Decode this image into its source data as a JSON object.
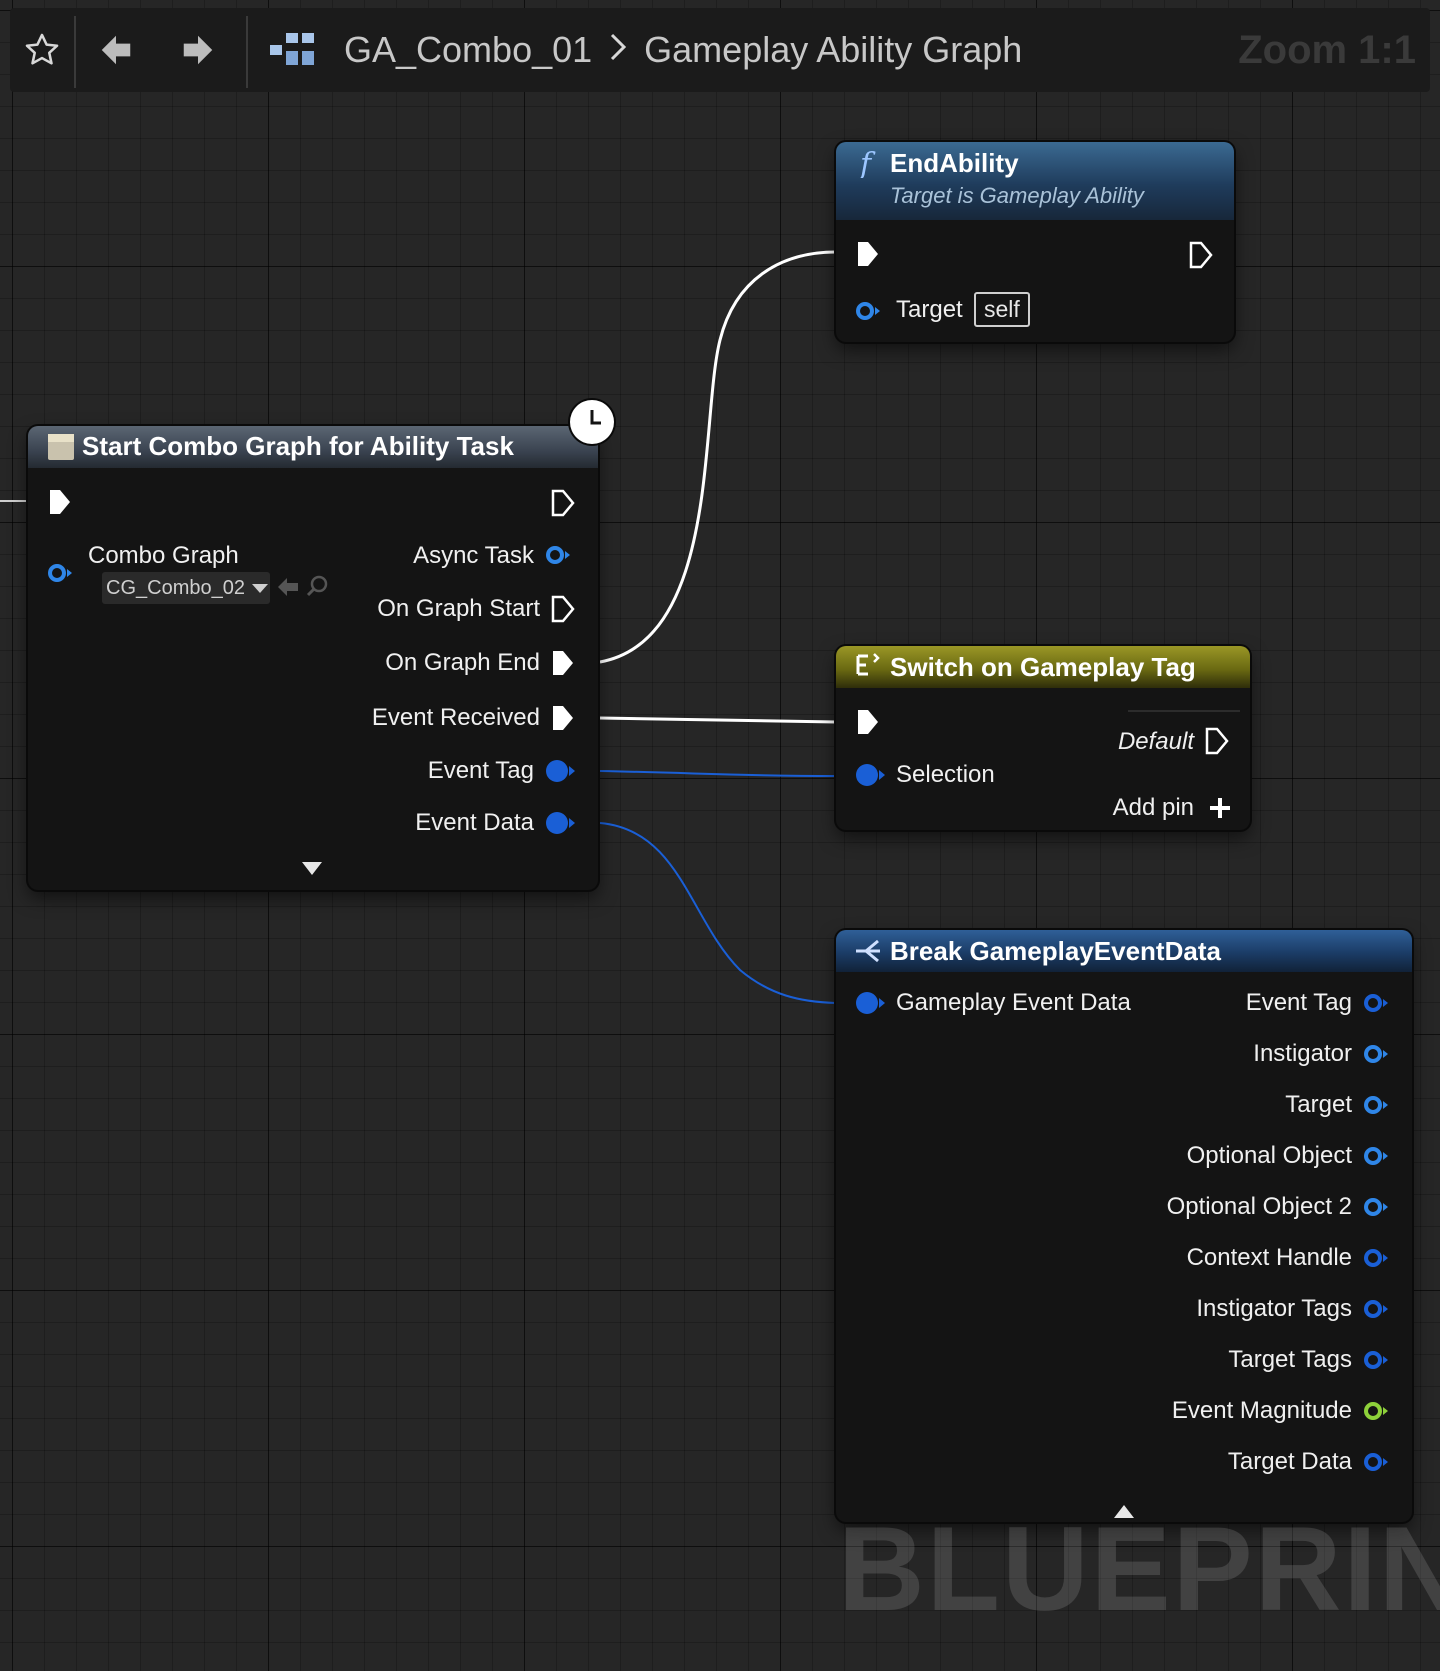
{
  "toolbar": {
    "breadcrumb_asset": "GA_Combo_01",
    "breadcrumb_graph": "Gameplay Ability Graph",
    "zoom_label": "Zoom 1:1",
    "icons": [
      "star-icon",
      "back-arrow-icon",
      "forward-arrow-icon",
      "graph-hierarchy-icon",
      "chevron-right-icon"
    ]
  },
  "watermark": "BLUEPRINT",
  "colors": {
    "canvas_bg": "#262626",
    "exec_pin": "#ffffff",
    "object_pin": "#1f6fe0",
    "struct_pin": "#1a5fd6",
    "float_pin": "#8ed13a",
    "function_header": "#1e3a5a",
    "switch_header": "#6b6a12",
    "break_header": "#1b3c66",
    "task_header": "#3a4350"
  },
  "nodes": {
    "end_ability": {
      "title": "EndAbility",
      "subtitle": "Target is Gameplay Ability",
      "target_label": "Target",
      "target_value": "self"
    },
    "start_combo": {
      "title": "Start Combo Graph for Ability Task",
      "combo_graph_label": "Combo Graph",
      "combo_graph_value": "CG_Combo_02",
      "outputs": [
        "Async Task",
        "On Graph Start",
        "On Graph End",
        "Event Received",
        "Event Tag",
        "Event Data"
      ]
    },
    "switch_tag": {
      "title": "Switch on Gameplay Tag",
      "default_label": "Default",
      "selection_label": "Selection",
      "add_pin_label": "Add pin"
    },
    "break_event": {
      "title": "Break GameplayEventData",
      "input_label": "Gameplay Event Data",
      "outputs": [
        "Event Tag",
        "Instigator",
        "Target",
        "Optional Object",
        "Optional Object 2",
        "Context Handle",
        "Instigator Tags",
        "Target Tags",
        "Event Magnitude",
        "Target Data"
      ]
    }
  }
}
